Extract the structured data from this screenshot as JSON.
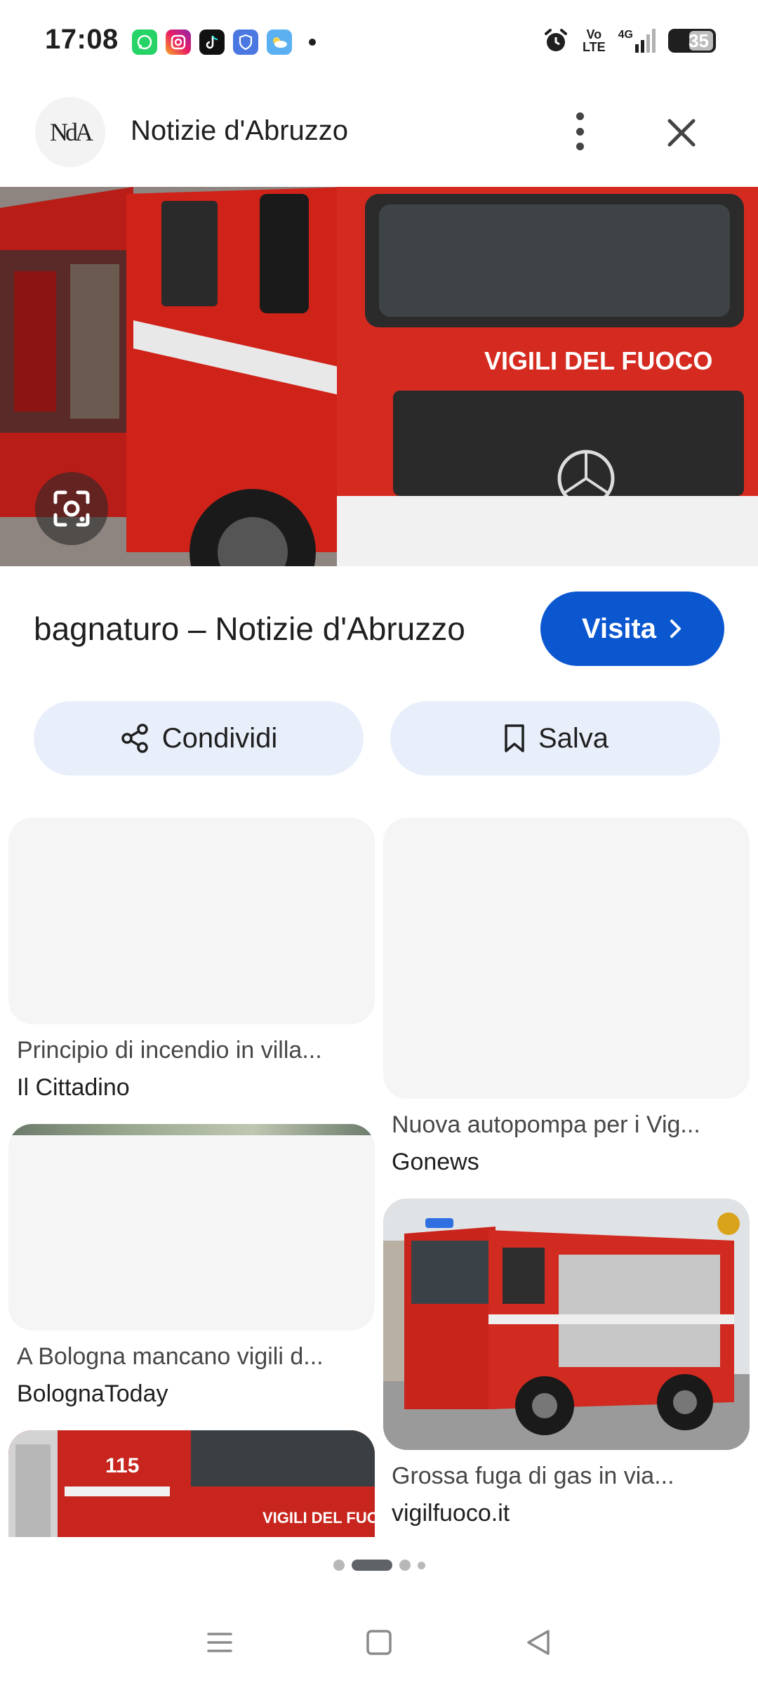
{
  "status_bar": {
    "time": "17:08",
    "notification_icons": [
      "whatsapp-icon",
      "instagram-icon",
      "tiktok-icon",
      "shield-app-icon",
      "weather-icon"
    ],
    "volte_label_top": "Vo",
    "volte_label_bottom": "LTE",
    "network_label": "4G",
    "battery_level": "35"
  },
  "header": {
    "logo_text": "NdA",
    "site_name": "Notizie d'Abruzzo"
  },
  "hero": {
    "image_description_icon": "fire-truck-image",
    "truck_text": "VIGILI DEL FUOCO"
  },
  "result": {
    "title": "bagnaturo – Notizie d'Abruzzo",
    "visit_label": "Visita"
  },
  "actions": {
    "share_label": "Condividi",
    "save_label": "Salva"
  },
  "related": [
    {
      "title": "Principio di incendio in villa...",
      "source": "Il Cittadino"
    },
    {
      "title": "Nuova autopompa per i Vig...",
      "source": "Gonews"
    },
    {
      "title": "A Bologna mancano vigili d...",
      "source": "BolognaToday"
    },
    {
      "title": "Grossa fuga di gas in via...",
      "source": "vigilfuoco.it"
    },
    {
      "title": "",
      "source": "",
      "truck_text": "VIGILI DEL FUOCO"
    }
  ],
  "pager": {
    "total": 4,
    "active": 2
  },
  "colors": {
    "accent": "#0b57d0",
    "chip_bg": "#e8effb",
    "truck_red": "#d0211b"
  }
}
